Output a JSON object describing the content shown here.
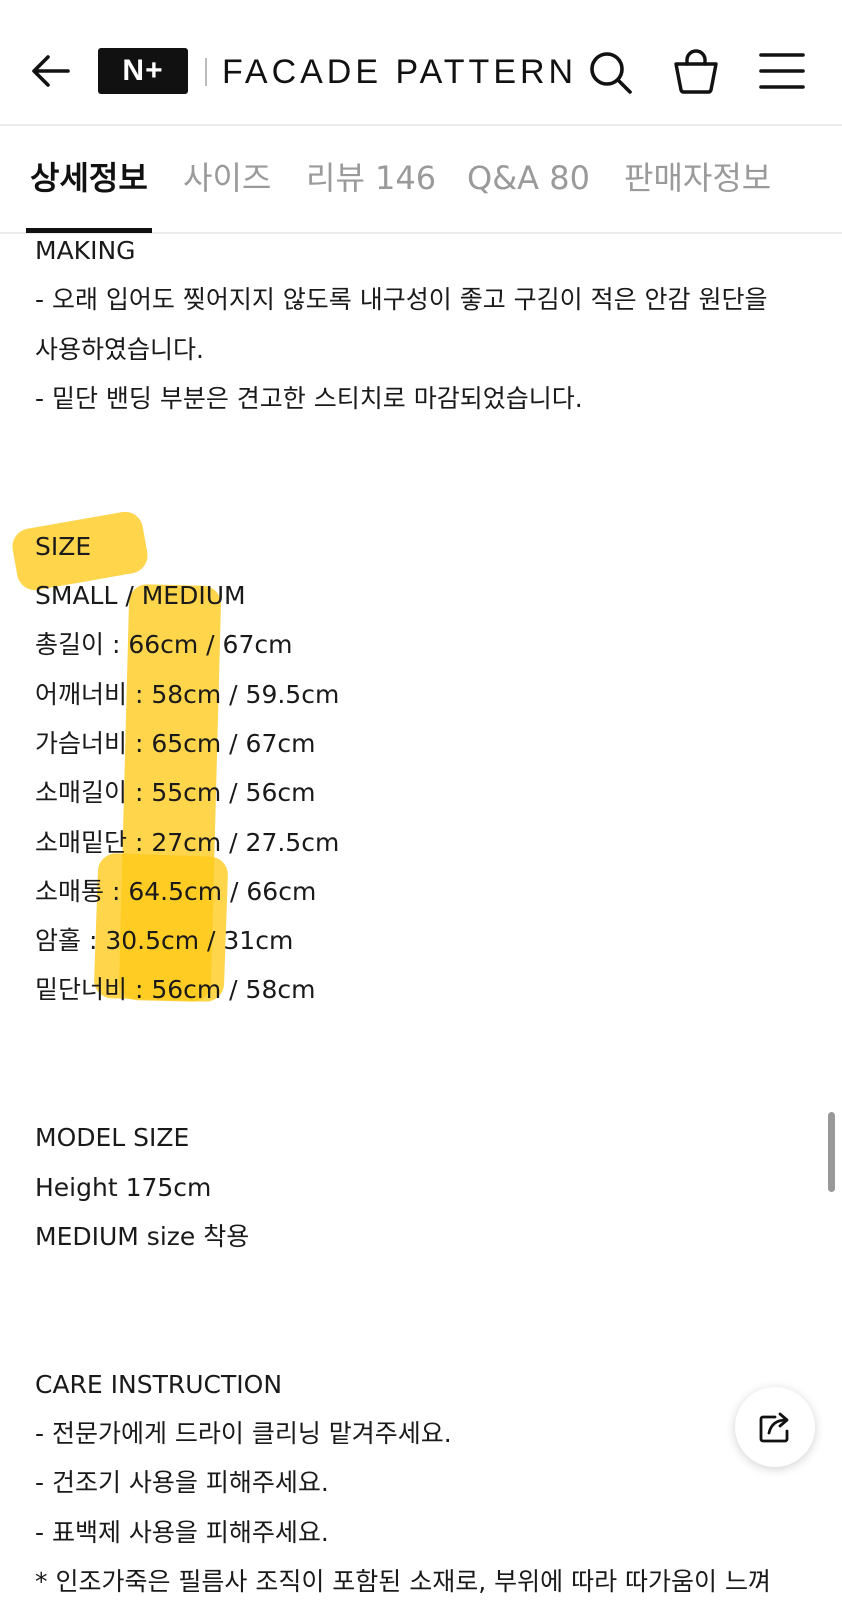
{
  "header": {
    "logo_badge": "N+",
    "brand": "FACADE PATTERN"
  },
  "tabs": [
    {
      "label": "상세정보",
      "active": true
    },
    {
      "label": "사이즈",
      "active": false
    },
    {
      "label": "리뷰 146",
      "active": false
    },
    {
      "label": "Q&A 80",
      "active": false
    },
    {
      "label": "판매자정보",
      "active": false
    }
  ],
  "making": {
    "heading": "MAKING",
    "lines": [
      "- 오래 입어도 찢어지지 않도록 내구성이 좋고 구김이 적은 안감 원단을",
      "사용하였습니다.",
      "- 밑단 밴딩 부분은 견고한 스티치로 마감되었습니다."
    ]
  },
  "size": {
    "heading": "SIZE",
    "columns": "SMALL / MEDIUM",
    "rows": [
      "총길이 : 66cm / 67cm",
      "어깨너비 : 58cm / 59.5cm",
      "가슴너비 : 65cm / 67cm",
      "소매길이 : 55cm / 56cm",
      "소매밑단 : 27cm / 27.5cm",
      "소매통 : 64.5cm / 66cm",
      "암홀 : 30.5cm / 31cm",
      "밑단너비 : 56cm / 58cm"
    ]
  },
  "model": {
    "heading": "MODEL SIZE",
    "lines": [
      "Height 175cm",
      "MEDIUM size 착용"
    ]
  },
  "care": {
    "heading": "CARE INSTRUCTION",
    "lines": [
      "- 전문가에게 드라이 클리닝 맡겨주세요.",
      "- 건조기 사용을 피해주세요.",
      "- 표백제 사용을 피해주세요.",
      "* 인조가죽은 필름사 조직이 포함된 소재로, 부위에 따라 따가움이 느껴"
    ]
  },
  "colors": {
    "highlight": "#ffc91a",
    "text": "#1a1a1a",
    "inactive_tab": "#9a9a9a"
  }
}
